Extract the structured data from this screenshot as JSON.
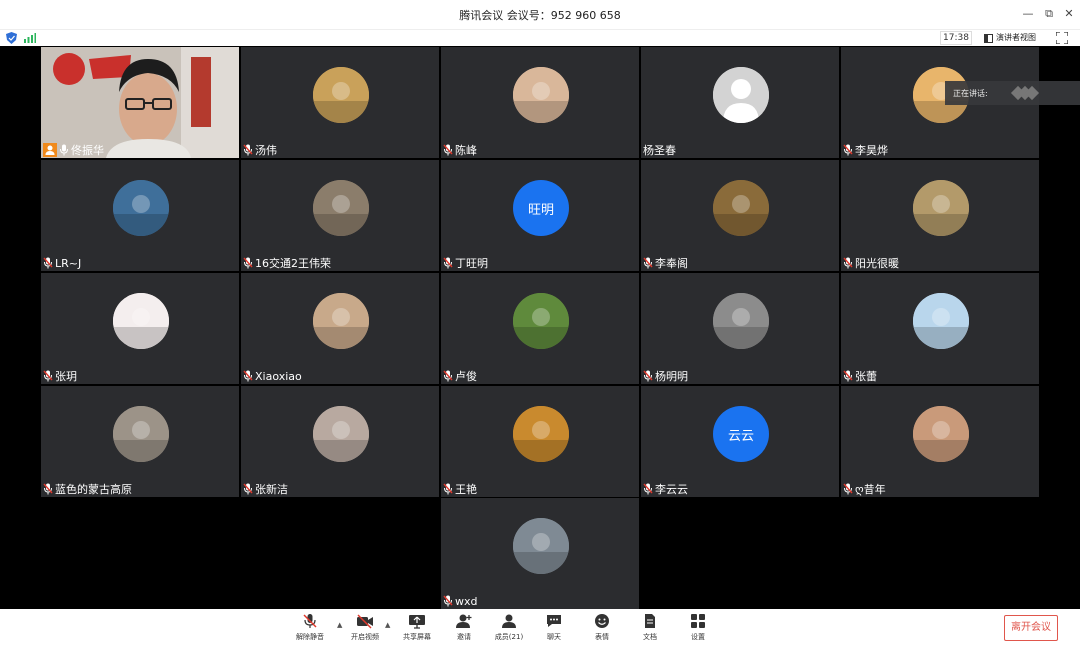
{
  "window": {
    "title": "腾讯会议 会议号：952 960 658",
    "minimize_glyph": "—",
    "restore_glyph": "⧉",
    "close_glyph": "✕"
  },
  "status": {
    "clock": "17:38",
    "speaker_view_label": "演讲者视图"
  },
  "speaking": {
    "label": "正在讲话:"
  },
  "participants": [
    {
      "name": "佟振华",
      "avatar_text": "",
      "avatar_color": "#8a8f96"
    },
    {
      "name": "汤伟",
      "avatar_text": "",
      "avatar_color": "#c9a15a"
    },
    {
      "name": "陈峰",
      "avatar_text": "",
      "avatar_color": "#d9b79a"
    },
    {
      "name": "杨圣春",
      "avatar_text": "",
      "avatar_color": "#d3d3d3"
    },
    {
      "name": "李昊烨",
      "avatar_text": "",
      "avatar_color": "#e8b56b"
    },
    {
      "name": "LR~J",
      "avatar_text": "",
      "avatar_color": "#3f6f9a"
    },
    {
      "name": "16交通2王伟荣",
      "avatar_text": "",
      "avatar_color": "#8b7d6b"
    },
    {
      "name": "丁旺明",
      "avatar_text": "旺明",
      "avatar_color": "#1a73f0"
    },
    {
      "name": "李奉阁",
      "avatar_text": "",
      "avatar_color": "#8a6b3a"
    },
    {
      "name": "阳光很暖",
      "avatar_text": "",
      "avatar_color": "#b39a6a"
    },
    {
      "name": "张玥",
      "avatar_text": "",
      "avatar_color": "#f4eeee"
    },
    {
      "name": "Xiaoxiao",
      "avatar_text": "",
      "avatar_color": "#c8a98a"
    },
    {
      "name": "卢俊",
      "avatar_text": "",
      "avatar_color": "#5f8a3c"
    },
    {
      "name": "杨明明",
      "avatar_text": "",
      "avatar_color": "#8c8c8c"
    },
    {
      "name": "张蕾",
      "avatar_text": "",
      "avatar_color": "#b9d6ec"
    },
    {
      "name": "蓝色的蒙古高原",
      "avatar_text": "",
      "avatar_color": "#9c9388"
    },
    {
      "name": "张新洁",
      "avatar_text": "",
      "avatar_color": "#b8a9a0"
    },
    {
      "name": "王艳",
      "avatar_text": "",
      "avatar_color": "#c98a2e"
    },
    {
      "name": "李云云",
      "avatar_text": "云云",
      "avatar_color": "#1a73f0"
    },
    {
      "name": "ღ昔年",
      "avatar_text": "",
      "avatar_color": "#c99a7a"
    },
    {
      "name": "wxd",
      "avatar_text": "",
      "avatar_color": "#7f8a94"
    }
  ],
  "toolbar": {
    "mute_label": "解除静音",
    "video_label": "开启视频",
    "share_label": "共享屏幕",
    "invite_label": "邀请",
    "members_label": "成员(21)",
    "chat_label": "聊天",
    "emoji_label": "表情",
    "docs_label": "文档",
    "settings_label": "设置",
    "leave_label": "离开会议"
  }
}
